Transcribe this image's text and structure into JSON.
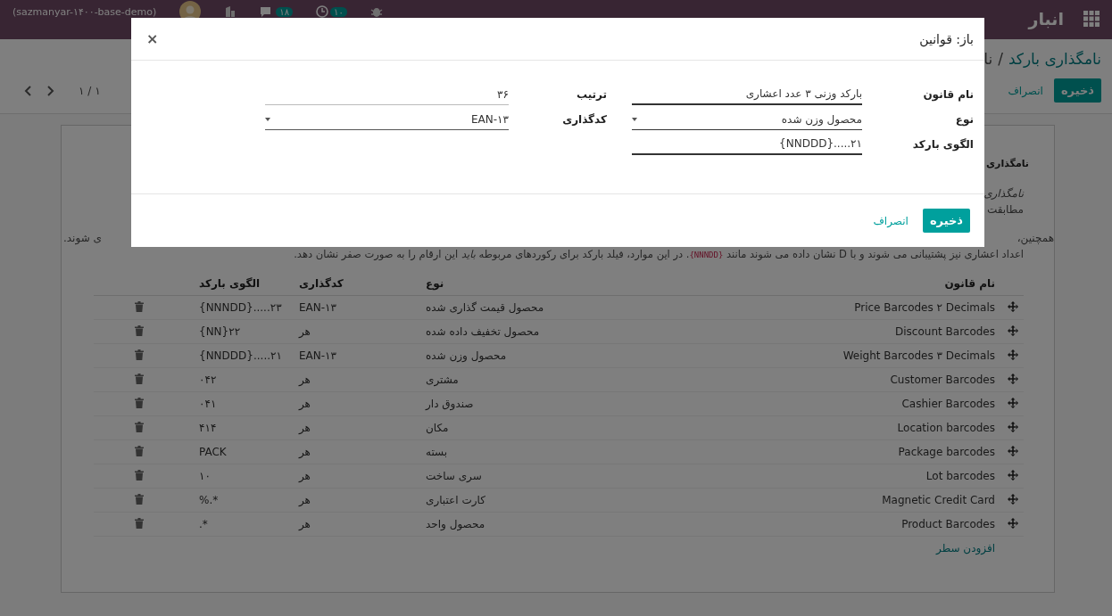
{
  "top_bar": {
    "app_name": "انبار",
    "database": "(sazmanyar-۱۴۰۰-base-demo)",
    "badges": [
      {
        "kind": "activity",
        "count": "۱۰"
      },
      {
        "kind": "chat",
        "count": "۱۸"
      }
    ]
  },
  "control_panel": {
    "breadcrumb": "نامگذاری بارکد",
    "breadcrumb_separator": "/",
    "breadcrumb_current": "نا",
    "save": "ذخیره",
    "discard": "انصراف",
    "pager": "۱ / ۱"
  },
  "sheet": {
    "title": "نامگذاری",
    "intro_italic": "نامگذاری",
    "intro_line": "مطابقت",
    "line_start": "همچنین،",
    "line_end": "ی شوند.",
    "paragraph": {
      "before": "اعداد اعشاری نیز پشتیبانی می شوند و با D نشان داده می شوند مانند ",
      "code": "{NNNDD}",
      "after": ". در این موارد، فیلد بارکد برای رکوردهای مربوطه *باید* این ارقام را به صورت صفر نشان دهد."
    }
  },
  "table": {
    "columns": [
      "نام قانون",
      "نوع",
      "کدگذاری",
      "الگوی بارکد"
    ],
    "rows": [
      {
        "name": "Price Barcodes ۲ Decimals",
        "type": "محصول قیمت گذاری شده",
        "encoding": "EAN-۱۳",
        "pattern": "{NNNDD}.....۲۳"
      },
      {
        "name": "Discount Barcodes",
        "type": "محصول تخفیف داده شده",
        "encoding": "هر",
        "pattern": "{NN}۲۲"
      },
      {
        "name": "Weight Barcodes ۳ Decimals",
        "type": "محصول وزن شده",
        "encoding": "EAN-۱۳",
        "pattern": "{NNDDD}.....۲۱"
      },
      {
        "name": "Customer Barcodes",
        "type": "مشتری",
        "encoding": "هر",
        "pattern": "۰۴۲"
      },
      {
        "name": "Cashier Barcodes",
        "type": "صندوق دار",
        "encoding": "هر",
        "pattern": "۰۴۱"
      },
      {
        "name": "Location barcodes",
        "type": "مکان",
        "encoding": "هر",
        "pattern": "۴۱۴"
      },
      {
        "name": "Package barcodes",
        "type": "بسته",
        "encoding": "هر",
        "pattern": "PACK"
      },
      {
        "name": "Lot barcodes",
        "type": "سری ساخت",
        "encoding": "هر",
        "pattern": "۱۰"
      },
      {
        "name": "Magnetic Credit Card",
        "type": "کارت اعتباری",
        "encoding": "هر",
        "pattern": "%.*"
      },
      {
        "name": "Product Barcodes",
        "type": "محصول واحد",
        "encoding": "هر",
        "pattern": ".*"
      }
    ],
    "add_line": "افزودن سطر"
  },
  "dialog": {
    "title": "باز: قوانین",
    "close": "×",
    "fields_right": [
      {
        "label": "نام قانون",
        "value": "بارکد وزنی ۳ عدد اعشاری",
        "kind": "text"
      },
      {
        "label": "نوع",
        "value": "محصول وزن شده",
        "kind": "select"
      },
      {
        "label": "الگوی بارکد",
        "value": "{NNDDD}.....۲۱",
        "kind": "text"
      }
    ],
    "fields_left": [
      {
        "label": "ترتیب",
        "value": "۳۶",
        "kind": "text"
      },
      {
        "label": "کدگذاری",
        "value": "EAN-۱۳",
        "kind": "select"
      }
    ],
    "save": "ذخیره",
    "discard": "انصراف"
  }
}
